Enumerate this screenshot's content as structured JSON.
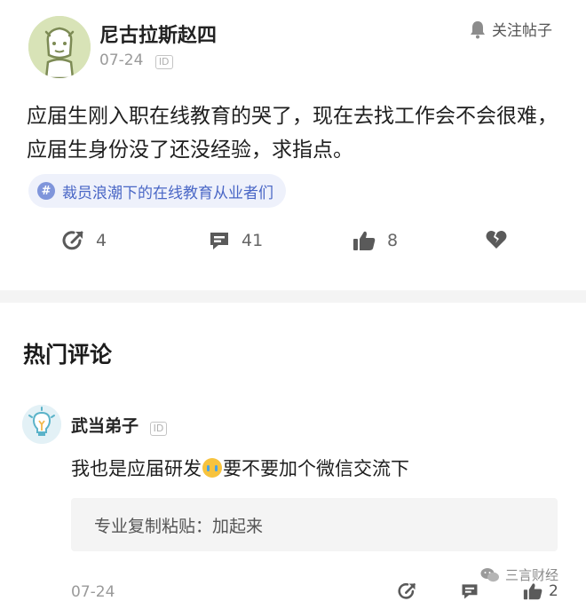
{
  "post": {
    "author_name": "尼古拉斯赵四",
    "date": "07-24",
    "id_badge": "ID",
    "follow_label": "关注帖子",
    "content": "应届生刚入职在线教育的哭了，现在去找工作会不会很难，应届生身份没了还没经验，求指点。",
    "topic_hash": "#",
    "topic": "裁员浪潮下的在线教育从业者们",
    "actions": {
      "share_count": "4",
      "comment_count": "41",
      "like_count": "8"
    }
  },
  "hot_comments": {
    "title": "热门评论",
    "items": [
      {
        "name": "武当弟子",
        "id_badge": "ID",
        "text_before_emoji": "我也是应届研发",
        "text_after_emoji": "要不要加个微信交流下",
        "reply": "专业复制粘贴：加起来",
        "date": "07-24",
        "like_count": "2"
      }
    ]
  },
  "watermark": {
    "text": "三言财经"
  },
  "icons": {
    "avatar": "cartoon-avatar",
    "bell": "bell-icon",
    "share": "share-icon",
    "comment": "comment-icon",
    "like": "thumbs-up-icon",
    "dislike": "broken-heart-icon",
    "lightbulb": "lightbulb-avatar-icon",
    "wechat": "wechat-icon"
  },
  "colors": {
    "topic_text": "#4a67c6",
    "topic_bg": "#eef1fb",
    "icon_gray": "#555555",
    "avatar_bg": "#d8e3b7"
  }
}
